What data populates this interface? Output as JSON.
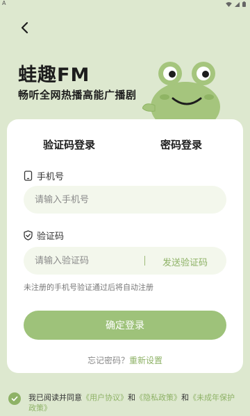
{
  "status_bar": {
    "left_text": "A"
  },
  "header": {
    "app_name": "蛙趣FM",
    "slogan": "畅听全网热播高能广播剧"
  },
  "tabs": {
    "sms_login": "验证码登录",
    "password_login": "密码登录"
  },
  "form": {
    "phone_label": "手机号",
    "phone_placeholder": "请输入手机号",
    "phone_value": "",
    "code_label": "验证码",
    "code_placeholder": "请输入验证码",
    "code_value": "",
    "send_code": "发送验证码",
    "hint": "未注册的手机号验证通过后将自动注册",
    "submit": "确定登录",
    "forgot_prefix": "忘记密码？",
    "forgot_link": "重新设置"
  },
  "agreement": {
    "prefix": "我已阅读并同意",
    "user_agreement": "《用户协议》",
    "and1": "和",
    "privacy_policy": "《隐私政策》",
    "and2": "和",
    "minor_policy": "《未成年保护政策》"
  },
  "colors": {
    "background": "#dde8cf",
    "accent": "#9ec27a",
    "link": "#8eb266",
    "frog": "#a5c57d"
  },
  "icons": {
    "back": "chevron-left-icon",
    "phone": "phone-icon",
    "shield": "shield-check-icon",
    "check": "check-icon"
  }
}
